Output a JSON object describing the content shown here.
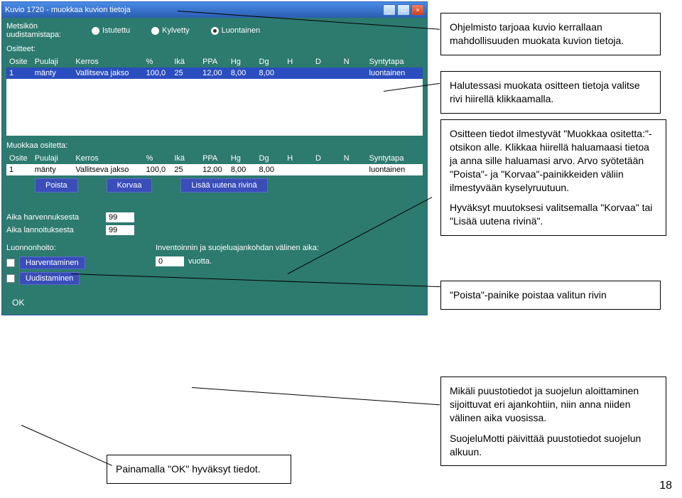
{
  "window": {
    "title": "Kuvio 1720 - muokkaa kuvion tietoja",
    "min_icon": "_",
    "max_icon": "□",
    "close_icon": "×"
  },
  "regen": {
    "label": "Metsikön uudistamistapa:",
    "options": [
      "Istutettu",
      "Kylvetty",
      "Luontainen"
    ],
    "selected": 2
  },
  "parts": {
    "label": "Ositteet:",
    "cols": [
      "Osite",
      "Puulaji",
      "Kerros",
      "%",
      "Ikä",
      "PPA",
      "Hg",
      "Dg",
      "H",
      "D",
      "N",
      "Syntytapa"
    ],
    "row": [
      "1",
      "mänty",
      "Vallitseva jakso",
      "100,0",
      "25",
      "12,00",
      "8,00",
      "8,00",
      "",
      "",
      "",
      "luontainen"
    ]
  },
  "edit": {
    "label": "Muokkaa ositetta:",
    "cols": [
      "Osite",
      "Puulaji",
      "Kerros",
      "%",
      "Ikä",
      "PPA",
      "Hg",
      "Dg",
      "H",
      "D",
      "N",
      "Syntytapa"
    ],
    "row": [
      "1",
      "mänty",
      "Vallitseva jakso",
      "100,0",
      "25",
      "12,00",
      "8,00",
      "8,00",
      "",
      "",
      "",
      "luontainen"
    ],
    "btn_delete": "Poista",
    "btn_replace": "Korvaa",
    "btn_addrow": "Lisää uutena rivinä"
  },
  "times": {
    "thin_label": "Aika harvennuksesta",
    "thin_val": "99",
    "fert_label": "Aika lannoituksesta",
    "fert_val": "99"
  },
  "nature": {
    "label": "Luonnonhoito:",
    "chk1": "Harventaminen",
    "chk2": "Uudistaminen"
  },
  "interval": {
    "label": "Inventoinnin ja suojeluajankohdan välinen aika:",
    "val": "0",
    "unit": "vuotta."
  },
  "ok_label": "OK",
  "anno": {
    "a1": "Ohjelmisto tarjoaa kuvio kerrallaan mahdollisuuden muokata kuvion tietoja.",
    "a2": "Halutessasi muokata ositteen tietoja valitse rivi hiirellä klikkaamalla.",
    "a3_1": "Ositteen tiedot ilmestyvät \"Muokkaa ositetta:\"-otsikon alle. Klikkaa hiirellä haluamaasi tietoa ja anna sille haluamasi arvo. Arvo syötetään \"Poista\"- ja \"Korvaa\"-painikkeiden väliin ilmestyvään kyselyruutuun.",
    "a3_2": "Hyväksyt muutoksesi valitsemalla \"Korvaa\" tai \"Lisää uutena rivinä\".",
    "a4": "\"Poista\"-painike poistaa valitun rivin",
    "a5_1": "Mikäli puustotiedot ja suojelun aloittaminen sijoittuvat eri ajankohtiin, niin anna niiden välinen aika vuosissa.",
    "a5_2": "SuojeluMotti päivittää puustotiedot suojelun alkuun.",
    "a6": "Painamalla \"OK\" hyväksyt tiedot."
  },
  "pagenum": "18"
}
